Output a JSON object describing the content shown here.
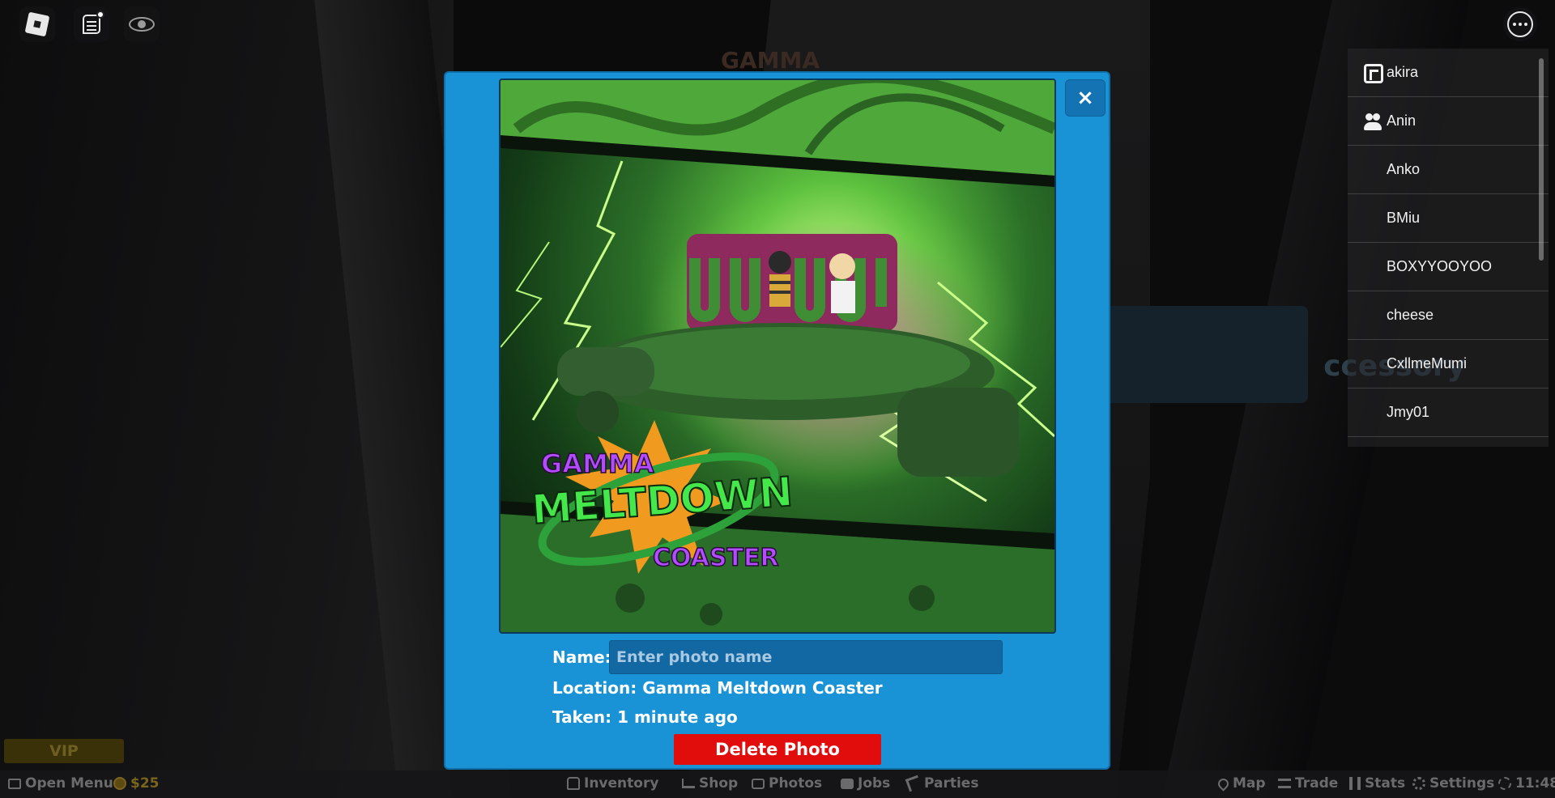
{
  "world": {
    "sign_text": "ccessory",
    "top_sign_text": "GAMMA"
  },
  "topbar": {
    "roblox_menu_icon": "roblox-logo-icon",
    "chat_icon": "chat-icon",
    "camera_icon": "eye-icon",
    "more_icon": "more-options-icon"
  },
  "players": [
    {
      "name": "akira",
      "icon": "premium-icon"
    },
    {
      "name": "Anin",
      "icon": "friends-icon"
    },
    {
      "name": "Anko",
      "icon": ""
    },
    {
      "name": "BMiu",
      "icon": ""
    },
    {
      "name": "BOXYYOOYOO",
      "icon": ""
    },
    {
      "name": "cheese",
      "icon": ""
    },
    {
      "name": "CxllmeMumi",
      "icon": ""
    },
    {
      "name": "Jmy01",
      "icon": ""
    }
  ],
  "photo_modal": {
    "close_label": "×",
    "logo": {
      "line1": "GAMMA",
      "line2": "MELTDOWN",
      "line3": "COASTER"
    },
    "name_label": "Name:",
    "name_value": "",
    "name_placeholder": "Enter photo name",
    "location_text": "Location: Gamma Meltdown Coaster",
    "taken_text": "Taken: 1 minute ago",
    "delete_label": "Delete Photo",
    "accent_color": "#1a93d6",
    "delete_color": "#e10d0d"
  },
  "bottom_left": {
    "vip_label": "VIP",
    "open_menu_label": "Open Menu",
    "money_label": "$25"
  },
  "bottom_nav": [
    {
      "label": "Inventory",
      "icon": "backpack-icon"
    },
    {
      "label": "Shop",
      "icon": "cart-icon"
    },
    {
      "label": "Photos",
      "icon": "camera-icon"
    },
    {
      "label": "Jobs",
      "icon": "briefcase-icon"
    },
    {
      "label": "Parties",
      "icon": "party-icon"
    }
  ],
  "bottom_right": [
    {
      "label": "Map",
      "icon": "map-icon"
    },
    {
      "label": "Trade",
      "icon": "trade-icon"
    },
    {
      "label": "Stats",
      "icon": "stats-icon"
    },
    {
      "label": "Settings",
      "icon": "gear-icon"
    },
    {
      "label": "11:48",
      "icon": "sun-icon"
    }
  ]
}
